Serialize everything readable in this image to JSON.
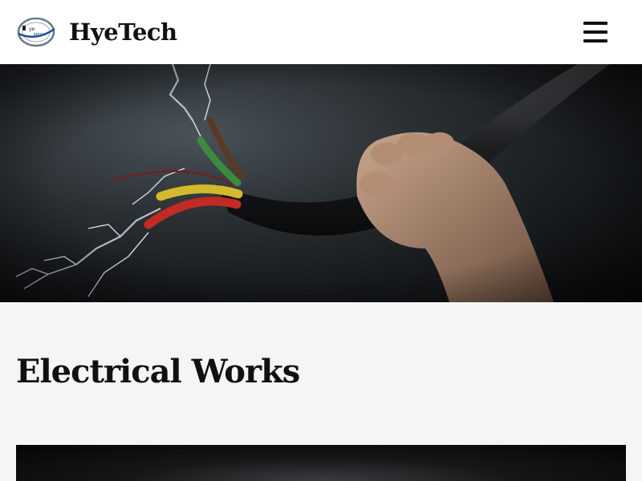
{
  "header": {
    "brand": "HyeTech",
    "logo_icon": "hyetech-logo-icon",
    "menu_icon": "hamburger-menu-icon"
  },
  "hero": {
    "image": "hand gripping stripped electrical cable with sparks"
  },
  "main": {
    "title": "Electrical Works"
  },
  "colors": {
    "header_bg": "#ffffff",
    "page_bg": "#f5f5f5",
    "text": "#111111"
  }
}
